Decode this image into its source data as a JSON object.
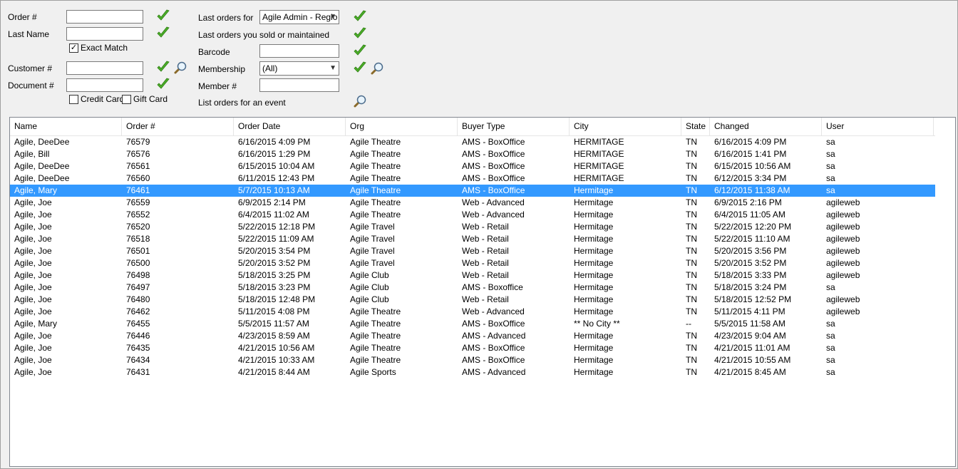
{
  "search": {
    "order_label": "Order #",
    "order_value": "",
    "last_name_label": "Last Name",
    "last_name_value": "",
    "exact_match_label": "Exact Match",
    "exact_match_checked": true,
    "customer_label": "Customer #",
    "customer_value": "",
    "document_label": "Document #",
    "document_value": "",
    "credit_card_label": "Credit Card",
    "gift_card_label": "Gift Card",
    "last_orders_for_label": "Last orders for",
    "last_orders_for_value": "Agile Admin - Regio",
    "last_orders_sold_label": "Last orders you sold or maintained",
    "barcode_label": "Barcode",
    "barcode_value": "",
    "membership_label": "Membership",
    "membership_value": "(All)",
    "member_label": "Member #",
    "member_value": "",
    "list_event_label": "List orders for an event"
  },
  "colors": {
    "selection": "#3399ff",
    "check": "#4caf2a"
  },
  "icons": {
    "go": "check-icon",
    "lookup": "magnifier-icon"
  },
  "grid": {
    "columns": [
      "Name",
      "Order #",
      "Order Date",
      "Org",
      "Buyer Type",
      "City",
      "State",
      "Changed",
      "User"
    ],
    "selected_row": 4,
    "rows": [
      [
        "Agile, DeeDee",
        "76579",
        "6/16/2015 4:09 PM",
        "Agile Theatre",
        "AMS - BoxOffice",
        "HERMITAGE",
        "TN",
        "6/16/2015 4:09 PM",
        "sa"
      ],
      [
        "Agile, Bill",
        "76576",
        "6/16/2015 1:29 PM",
        "Agile Theatre",
        "AMS - BoxOffice",
        "HERMITAGE",
        "TN",
        "6/16/2015 1:41 PM",
        "sa"
      ],
      [
        "Agile, DeeDee",
        "76561",
        "6/15/2015 10:04 AM",
        "Agile Theatre",
        "AMS - BoxOffice",
        "HERMITAGE",
        "TN",
        "6/15/2015 10:56 AM",
        "sa"
      ],
      [
        "Agile, DeeDee",
        "76560",
        "6/11/2015 12:43 PM",
        "Agile Theatre",
        "AMS - BoxOffice",
        "HERMITAGE",
        "TN",
        "6/12/2015 3:34 PM",
        "sa"
      ],
      [
        "Agile, Mary",
        "76461",
        "5/7/2015 10:13 AM",
        "Agile Theatre",
        "AMS - BoxOffice",
        "Hermitage",
        "TN",
        "6/12/2015 11:38 AM",
        "sa"
      ],
      [
        "Agile, Joe",
        "76559",
        "6/9/2015 2:14 PM",
        "Agile Theatre",
        "Web - Advanced",
        "Hermitage",
        "TN",
        "6/9/2015 2:16 PM",
        "agileweb"
      ],
      [
        "Agile, Joe",
        "76552",
        "6/4/2015 11:02 AM",
        "Agile Theatre",
        "Web - Advanced",
        "Hermitage",
        "TN",
        "6/4/2015 11:05 AM",
        "agileweb"
      ],
      [
        "Agile, Joe",
        "76520",
        "5/22/2015 12:18 PM",
        "Agile Travel",
        "Web - Retail",
        "Hermitage",
        "TN",
        "5/22/2015 12:20 PM",
        "agileweb"
      ],
      [
        "Agile, Joe",
        "76518",
        "5/22/2015 11:09 AM",
        "Agile Travel",
        "Web - Retail",
        "Hermitage",
        "TN",
        "5/22/2015 11:10 AM",
        "agileweb"
      ],
      [
        "Agile, Joe",
        "76501",
        "5/20/2015 3:54 PM",
        "Agile Travel",
        "Web - Retail",
        "Hermitage",
        "TN",
        "5/20/2015 3:56 PM",
        "agileweb"
      ],
      [
        "Agile, Joe",
        "76500",
        "5/20/2015 3:52 PM",
        "Agile Travel",
        "Web - Retail",
        "Hermitage",
        "TN",
        "5/20/2015 3:52 PM",
        "agileweb"
      ],
      [
        "Agile, Joe",
        "76498",
        "5/18/2015 3:25 PM",
        "Agile Club",
        "Web - Retail",
        "Hermitage",
        "TN",
        "5/18/2015 3:33 PM",
        "agileweb"
      ],
      [
        "Agile, Joe",
        "76497",
        "5/18/2015 3:23 PM",
        "Agile Club",
        "AMS - Boxoffice",
        "Hermitage",
        "TN",
        "5/18/2015 3:24 PM",
        "sa"
      ],
      [
        "Agile, Joe",
        "76480",
        "5/18/2015 12:48 PM",
        "Agile Club",
        "Web - Retail",
        "Hermitage",
        "TN",
        "5/18/2015 12:52 PM",
        "agileweb"
      ],
      [
        "Agile, Joe",
        "76462",
        "5/11/2015 4:08 PM",
        "Agile Theatre",
        "Web - Advanced",
        "Hermitage",
        "TN",
        "5/11/2015 4:11 PM",
        "agileweb"
      ],
      [
        "Agile, Mary",
        "76455",
        "5/5/2015 11:57 AM",
        "Agile Theatre",
        "AMS - BoxOffice",
        "** No City **",
        "--",
        "5/5/2015 11:58 AM",
        "sa"
      ],
      [
        "Agile, Joe",
        "76446",
        "4/23/2015 8:59 AM",
        "Agile Theatre",
        "AMS - Advanced",
        "Hermitage",
        "TN",
        "4/23/2015 9:04 AM",
        "sa"
      ],
      [
        "Agile, Joe",
        "76435",
        "4/21/2015 10:56 AM",
        "Agile Theatre",
        "AMS - BoxOffice",
        "Hermitage",
        "TN",
        "4/21/2015 11:01 AM",
        "sa"
      ],
      [
        "Agile, Joe",
        "76434",
        "4/21/2015 10:33 AM",
        "Agile Theatre",
        "AMS - BoxOffice",
        "Hermitage",
        "TN",
        "4/21/2015 10:55 AM",
        "sa"
      ],
      [
        "Agile, Joe",
        "76431",
        "4/21/2015 8:44 AM",
        "Agile Sports",
        "AMS - Advanced",
        "Hermitage",
        "TN",
        "4/21/2015 8:45 AM",
        "sa"
      ]
    ]
  }
}
